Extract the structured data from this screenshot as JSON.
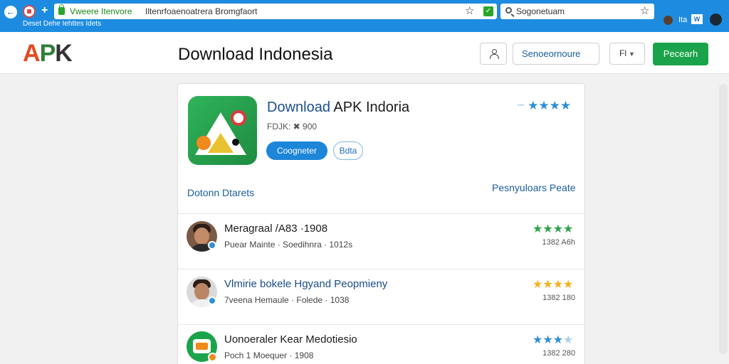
{
  "browser": {
    "url_host": "Vweere Itenvore",
    "url_path": "Iltenrfoaenoatrera Bromgfaort",
    "search_text": "Sogonetuam",
    "bookmarks": "Deset   Dehe   Iehttes   Idets",
    "toolbar_text": "Ita",
    "toolbar_box": "W"
  },
  "header": {
    "logo": {
      "part1": "A",
      "part2": "P",
      "part3": "K"
    },
    "title": "Download Indonesia",
    "search_button": "Senoeornoure",
    "menu_button": "Fl",
    "primary_button": "Pecearh"
  },
  "app": {
    "title_highlight": "Download",
    "title_rest": " APK Indoria",
    "meta": "FDJK:  ✖ 900",
    "install_button": "Coogneter",
    "secondary_button": "Bdta",
    "rating_stars": "★★★★"
  },
  "sections": {
    "left": "Dotonn Dtarets",
    "right": "Pesnyuloars Peate"
  },
  "reviews": [
    {
      "title": "Meragraal /A83 ·1908",
      "subtitle": "Puear Mainte · Soedihnra · 1012s",
      "stars": "★★★★",
      "count": "1382 A6h"
    },
    {
      "title": "Vlmirie bokele Hgyand Peopmieny",
      "subtitle": "7veena Hemaule · Folede · 1038",
      "stars": "★★★★",
      "count": "1382 180"
    },
    {
      "title": "Uonoeraler Kear Medotiesio",
      "subtitle": "Poch 1 Moequer · 1908",
      "stars": "★★★",
      "count": "1382 280"
    }
  ]
}
